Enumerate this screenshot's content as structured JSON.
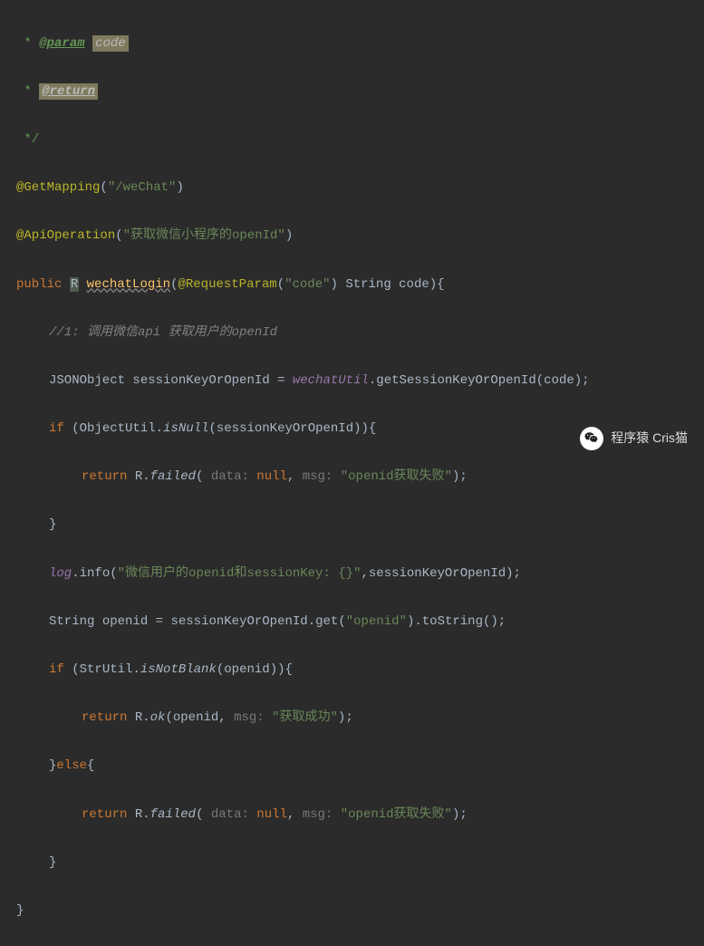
{
  "javadoc": {
    "star": " * ",
    "param_tag": "@param",
    "param_name": "code",
    "return_tag": "@return",
    "end": " */"
  },
  "annotations": {
    "getmapping": "@GetMapping",
    "getmapping_value": "\"/weChat\"",
    "apioperation": "@ApiOperation",
    "apioperation_value": "\"获取微信小程序的openId\"",
    "requestparam": "@RequestParam",
    "requestparam_value": "\"code\""
  },
  "keywords": {
    "public": "public",
    "if": "if",
    "else": "else",
    "return": "return",
    "null": "null"
  },
  "types": {
    "R": "R",
    "String": "String",
    "JSONObject": "JSONObject"
  },
  "method": {
    "name": "wechatLogin",
    "param_name": "code"
  },
  "comment1": "//1: 调用微信api 获取用户的openId",
  "vars": {
    "sessionKeyOrOpenId": "sessionKeyOrOpenId",
    "wechatUtil": "wechatUtil",
    "openid": "openid"
  },
  "methods": {
    "getSessionKeyOrOpenId": "getSessionKeyOrOpenId",
    "isNull": "isNull",
    "failed": "failed",
    "info": "info",
    "get": "get",
    "toString": "toString",
    "isNotBlank": "isNotBlank",
    "ok": "ok"
  },
  "classes": {
    "ObjectUtil": "ObjectUtil",
    "StrUtil": "StrUtil",
    "R": "R",
    "log": "log"
  },
  "hints": {
    "data": "data:",
    "msg": "msg:"
  },
  "strings": {
    "openid_fail": "\"openid获取失败\"",
    "log_info": "\"微信用户的openid和sessionKey: {}\"",
    "openid_key": "\"openid\"",
    "success": "\"获取成功\""
  },
  "watermark": "程序猿 Cris猫"
}
